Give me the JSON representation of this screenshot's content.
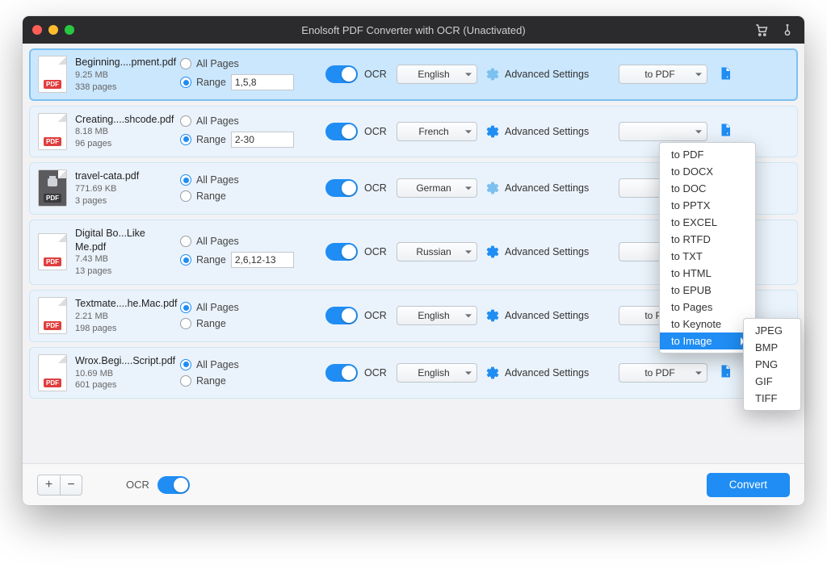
{
  "window": {
    "title": "Enolsoft PDF Converter with OCR (Unactivated)"
  },
  "labels": {
    "all_pages": "All Pages",
    "range": "Range",
    "ocr": "OCR",
    "advanced": "Advanced Settings",
    "convert": "Convert",
    "bottom_ocr": "OCR"
  },
  "files": [
    {
      "name": "Beginning....pment.pdf",
      "size": "9.25 MB",
      "pages": "338 pages",
      "mode": "range",
      "range": "1,5,8",
      "lang": "English",
      "format": "to PDF",
      "locked": false,
      "selected": true
    },
    {
      "name": "Creating....shcode.pdf",
      "size": "8.18 MB",
      "pages": "96 pages",
      "mode": "range",
      "range": "2-30",
      "lang": "French",
      "format": "",
      "locked": false,
      "selected": false
    },
    {
      "name": "travel-cata.pdf",
      "size": "771.69 KB",
      "pages": "3 pages",
      "mode": "all",
      "range": "",
      "lang": "German",
      "format": "",
      "locked": true,
      "selected": false
    },
    {
      "name": "Digital Bo...Like Me.pdf",
      "size": "7.43 MB",
      "pages": "13 pages",
      "mode": "range",
      "range": "2,6,12-13",
      "lang": "Russian",
      "format": "",
      "locked": false,
      "selected": false
    },
    {
      "name": "Textmate....he.Mac.pdf",
      "size": "2.21 MB",
      "pages": "198 pages",
      "mode": "all",
      "range": "",
      "lang": "English",
      "format": "to PDF",
      "locked": false,
      "selected": false
    },
    {
      "name": "Wrox.Begi....Script.pdf",
      "size": "10.69 MB",
      "pages": "601 pages",
      "mode": "all",
      "range": "",
      "lang": "English",
      "format": "to PDF",
      "locked": false,
      "selected": false
    }
  ],
  "format_menu": {
    "items": [
      "to PDF",
      "to DOCX",
      "to DOC",
      "to PPTX",
      "to EXCEL",
      "to RTFD",
      "to TXT",
      "to HTML",
      "to EPUB",
      "to Pages",
      "to Keynote",
      "to Image"
    ],
    "highlighted": "to Image",
    "sub_items": [
      "JPEG",
      "BMP",
      "PNG",
      "GIF",
      "TIFF"
    ]
  },
  "thumb_badge": "PDF"
}
